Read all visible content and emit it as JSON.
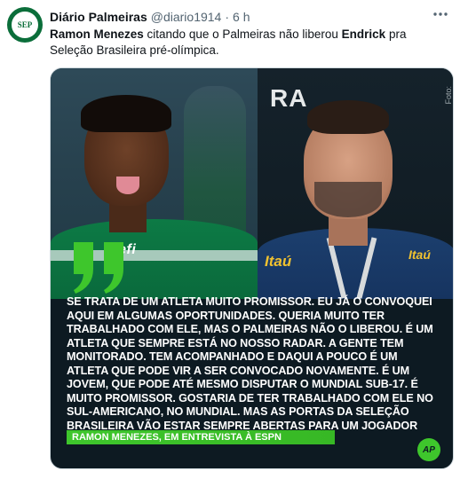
{
  "account": {
    "display_name": "Diário Palmeiras",
    "handle": "@diario1914",
    "separator": "·",
    "time": "6 h",
    "avatar_text": "SEP"
  },
  "tweet": {
    "bold_1": "Ramon Menezes",
    "text_1": " citando que o Palmeiras não liberou ",
    "bold_2": "Endrick",
    "text_2": " pra Seleção Brasileira pré-olímpica."
  },
  "image": {
    "left_sponsor": "crefi",
    "right_sign": "RA",
    "right_sponsor_1": "Itaú",
    "right_sponsor_2": "Itaú",
    "credit": "Foto:",
    "quote": "SE TRATA DE UM ATLETA MUITO PROMISSOR. EU JÁ O CONVOQUEI AQUI EM ALGUMAS OPORTUNIDADES. QUERIA MUITO TER TRABALHADO COM ELE, MAS O PALMEIRAS NÃO O LIBEROU. É UM ATLETA QUE SEMPRE ESTÁ NO NOSSO RADAR. A GENTE TEM MONITORADO. TEM ACOMPANHADO E DAQUI A POUCO É UM ATLETA QUE PODE VIR A SER CONVOCADO NOVAMENTE. É UM JOVEM, QUE PODE ATÉ MESMO DISPUTAR O MUNDIAL SUB-17. É MUITO PROMISSOR. GOSTARIA DE TER TRABALHADO COM ELE NO SUL-AMERICANO, NO MUNDIAL. MAS AS PORTAS DA SELEÇÃO BRASILEIRA VÃO ESTAR SEMPRE ABERTAS PARA UM JOGADOR COMO ELE",
    "source": "RAMON MENEZES, EM ENTREVISTA À ESPN",
    "logo_text": "AP"
  },
  "colors": {
    "quote_green": "#3ec62c",
    "palmeiras_green": "#0b6e3a"
  },
  "icons": [
    "more-icon",
    "quote-icon",
    "avatar-crest-icon"
  ]
}
